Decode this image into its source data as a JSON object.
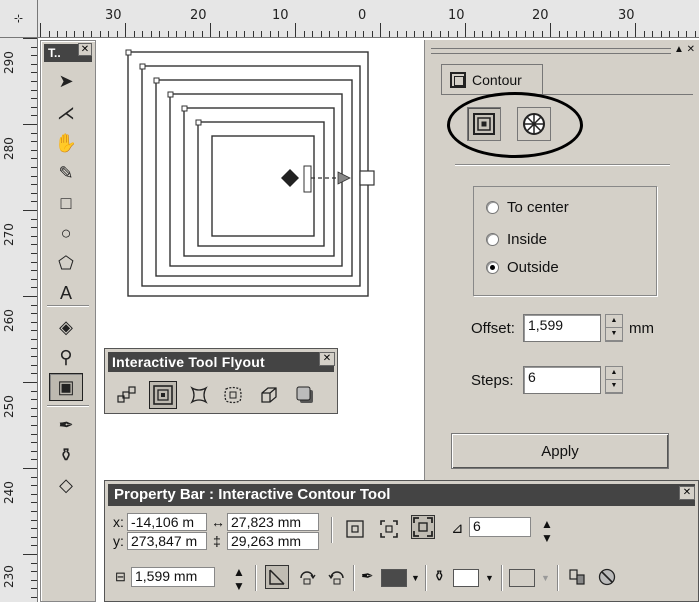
{
  "rulers": {
    "horizontal_labels": [
      "30",
      "20",
      "10",
      "0",
      "10",
      "20",
      "30"
    ],
    "vertical_labels": [
      "290",
      "280",
      "270",
      "260",
      "250",
      "240",
      "230"
    ],
    "corner_symbol": "⊹"
  },
  "toolbox": {
    "title": "T..",
    "close": "✕",
    "tools": [
      {
        "name": "pick-tool",
        "glyph": "➤"
      },
      {
        "name": "shape-tool",
        "glyph": "⋌"
      },
      {
        "name": "zoom-tool",
        "glyph": "✋"
      },
      {
        "name": "freehand-tool",
        "glyph": "✎"
      },
      {
        "name": "rectangle-tool",
        "glyph": "□"
      },
      {
        "name": "ellipse-tool",
        "glyph": "○"
      },
      {
        "name": "polygon-tool",
        "glyph": "⬠"
      },
      {
        "name": "text-tool",
        "glyph": "A"
      },
      {
        "name": "fill-tool",
        "glyph": "◈"
      },
      {
        "name": "eyedropper-tool",
        "glyph": "⚲"
      },
      {
        "name": "interactive-contour-tool",
        "glyph": "▣"
      },
      {
        "name": "outline-tool",
        "glyph": "✒"
      },
      {
        "name": "fill-flyout-tool",
        "glyph": "⚱"
      },
      {
        "name": "interactive-fill-tool",
        "glyph": "◇"
      }
    ]
  },
  "docker": {
    "tab_label": "Contour",
    "controls": "▲ ✕",
    "direction_options": [
      {
        "label": "To center",
        "checked": false
      },
      {
        "label": "Inside",
        "checked": false
      },
      {
        "label": "Outside",
        "checked": true
      }
    ],
    "offset_label": "Offset:",
    "offset_value": "1,599",
    "offset_unit": "mm",
    "steps_label": "Steps:",
    "steps_value": "6",
    "apply_label": "Apply"
  },
  "flyout": {
    "title": "Interactive Tool Flyout",
    "close": "✕",
    "tools": [
      "blend-tool",
      "contour-tool",
      "distortion-tool",
      "envelope-tool",
      "extrude-tool",
      "drop-shadow-tool"
    ]
  },
  "propbar": {
    "title": "Property Bar : Interactive Contour Tool",
    "close": "✕",
    "x_label": "x:",
    "x_value": "-14,106 m",
    "y_label": "y:",
    "y_value": "273,847 m",
    "w_icon": "↔",
    "w_value": "27,823 mm",
    "h_icon": "‡",
    "h_value": "29,263 mm",
    "steps_value": "6",
    "offset_value": "1,599 mm",
    "colors": {
      "outline_color": "#4a4a4a",
      "fill_color": "#ffffff",
      "accent_fill": "#d4d0c8"
    }
  }
}
